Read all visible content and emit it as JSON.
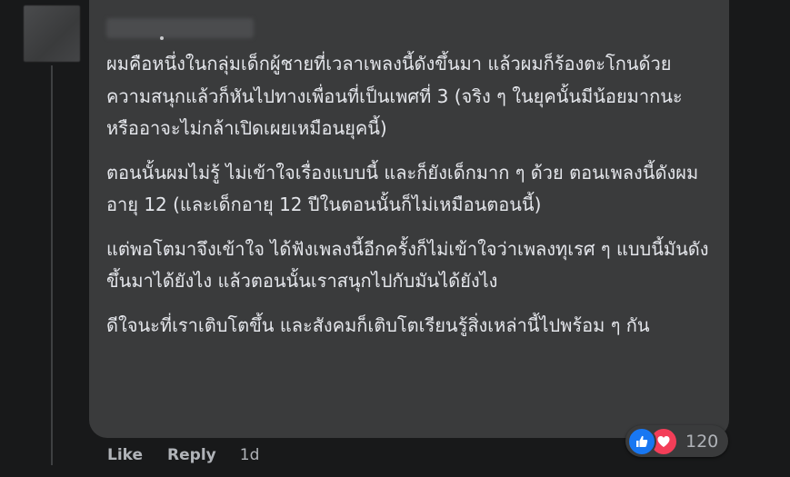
{
  "comment": {
    "paragraphs": [
      "ผมคือหนึ่งในกลุ่มเด็กผู้ชายที่เวลาเพลงนี้ดังขึ้นมา แล้วผมก็ร้องตะโกนด้วยความสนุกแล้วก็หันไปทางเพื่อนที่เป็นเพศที่ 3 (จริง ๆ ในยุคนั้นมีน้อยมากนะ หรืออาจะไม่กล้าเปิดเผยเหมือนยุคนี้)",
      "ตอนนั้นผมไม่รู้ ไม่เข้าใจเรื่องแบบนี้ และก็ยังเด็กมาก ๆ ด้วย ตอนเพลงนี้ดังผมอายุ 12 (และเด็กอายุ 12 ปีในตอนนั้นก็ไม่เหมือนตอนนี้)",
      "แต่พอโตมาจึงเข้าใจ ได้ฟังเพลงนี้อีกครั้งก็ไม่เข้าใจว่าเพลงทุเรศ ๆ แบบนี้มันดังขึ้นมาได้ยังไง แล้วตอนนั้นเราสนุกไปกับมันได้ยังไง",
      "ดีใจนะที่เราเติบโตขึ้น และสังคมก็เติบโตเรียนรู้สิ่งเหล่านี้ไปพร้อม ๆ กัน"
    ]
  },
  "actions": {
    "like_label": "Like",
    "reply_label": "Reply",
    "time": "1d"
  },
  "reactions": {
    "icons": [
      "like-icon",
      "love-icon"
    ],
    "count": "120",
    "colors": {
      "like": "#1877f2",
      "love": "#f33e58"
    }
  }
}
